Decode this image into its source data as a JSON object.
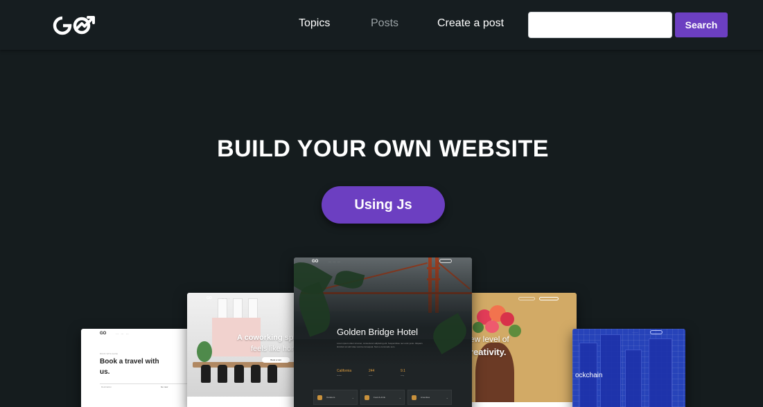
{
  "navbar": {
    "logo_text": "GO",
    "links": [
      {
        "label": "Topics",
        "muted": false
      },
      {
        "label": "Posts",
        "muted": true
      },
      {
        "label": "Create a post",
        "muted": false
      }
    ],
    "search": {
      "value": "",
      "placeholder": "",
      "button_label": "Search"
    }
  },
  "hero": {
    "title": "BUILD YOUR OWN WEBSITE",
    "cta_label": "Using Js"
  },
  "mockups": {
    "travel": {
      "kicker": "BOOK WITH EASE",
      "headline": "Book a travel with us.",
      "field_label": "Destination",
      "field_action": "Go now"
    },
    "coworking": {
      "line1": "A coworking spa",
      "line2": "feels like hon",
      "button": "Book a visit"
    },
    "hotel": {
      "title": "Golden Bridge Hotel",
      "description": "Lorem ipsum dolor sit amet, consectetur adipiscing elit. Suspendisse nec enim justo. Aliquam tincidunt at velit vitae viverra consequat. Nam a commodo sem.",
      "stats": [
        {
          "value": "California",
          "label": "location"
        },
        {
          "value": "244",
          "label": "rooms"
        },
        {
          "value": "9.1",
          "label": "rating"
        }
      ],
      "amenities": [
        "Outdoors",
        "Food & drink",
        "Amenities"
      ]
    },
    "creativity": {
      "line1": "ew level of",
      "line2": "reativity."
    },
    "blockchain": {
      "title": "ockchain"
    }
  },
  "colors": {
    "background": "#151c1e",
    "accent": "#6c3fc1"
  }
}
